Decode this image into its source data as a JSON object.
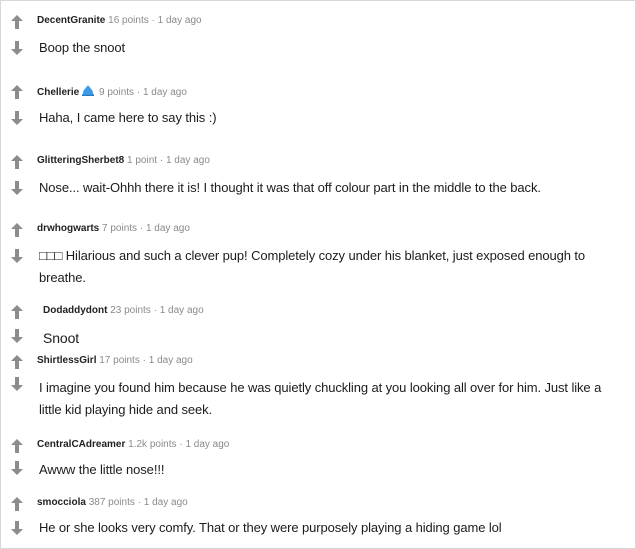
{
  "comments": [
    {
      "author": "DecentGranite",
      "flair": false,
      "points": "16 points",
      "age": "1 day ago",
      "text": "Boop the snoot"
    },
    {
      "author": "Chellerie",
      "flair": true,
      "points": "9 points",
      "age": "1 day ago",
      "text": "Haha, I came here to say this :)"
    },
    {
      "author": "GlitteringSherbet8",
      "flair": false,
      "points": "1 point",
      "age": "1 day ago",
      "text": "Nose... wait-Ohhh there it is! I thought it was that off colour part in the middle to the back."
    },
    {
      "author": "drwhogwarts",
      "flair": false,
      "points": "7 points",
      "age": "1 day ago",
      "text": "□□□ Hilarious and such a clever pup! Completely cozy under his blanket, just exposed enough to breathe."
    },
    {
      "author": "Dodaddydont",
      "flair": false,
      "points": "23 points",
      "age": "1 day ago",
      "text": "Snoot"
    },
    {
      "author": "ShirtlessGirl",
      "flair": false,
      "points": "17 points",
      "age": "1 day ago",
      "text": "I imagine you found him because he was quietly chuckling at you looking all over for him. Just like a little kid playing hide and seek."
    },
    {
      "author": "CentralCAdreamer",
      "flair": false,
      "points": "1.2k points",
      "age": "1 day ago",
      "text": "Awww the little nose!!!"
    },
    {
      "author": "smocciola",
      "flair": false,
      "points": "387 points",
      "age": "1 day ago",
      "text": "He or she looks very comfy. That or they were purposely playing a hiding game lol"
    }
  ],
  "separator": "·",
  "icons": {
    "upvote": "arrow-up-icon",
    "downvote": "arrow-down-icon",
    "flair": "water-drop-flair-icon"
  },
  "colors": {
    "arrow": "#8c8c8c",
    "meta": "#8a8a8a",
    "text": "#1c1c1c",
    "flair": "#3b9be8"
  }
}
